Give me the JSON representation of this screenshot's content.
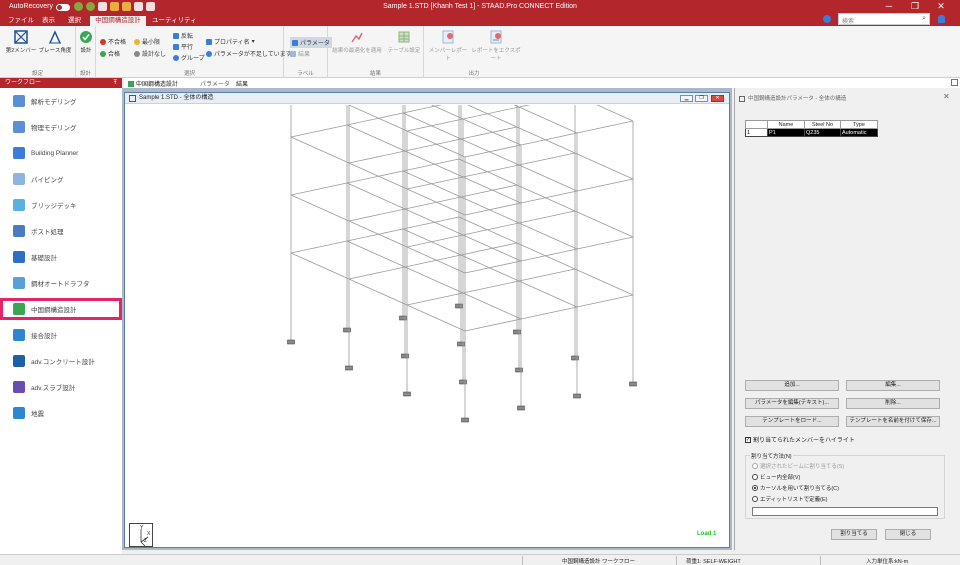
{
  "titlebar": {
    "autorecovery": "AutoRecovery",
    "toggle_state": "on",
    "title": "Sample 1.STD [Khanh Test 1] - STAAD.Pro CONNECT Edition",
    "minimize": "─",
    "restore": "❐",
    "close": "✕"
  },
  "menu": {
    "tabs": [
      "ファイル",
      "表示",
      "選択",
      "中国鋼構造設計",
      "ユーティリティ"
    ],
    "active": "中国鋼構造設計",
    "search_placeholder": "検索"
  },
  "ribbon": {
    "settings": {
      "btn1": "第2メンバー",
      "btn2": "ブレース角度",
      "label": "設定"
    },
    "design": {
      "btn": "設計",
      "label": "設計"
    },
    "select": {
      "fail": "不合格",
      "pass": "合格",
      "minimal": "最小限",
      "no_design": "設計なし",
      "reverse": "反転",
      "parallel": "平行",
      "group": "グループ",
      "property_name": "プロパティ名",
      "param_missing": "パラメータが不足しています",
      "label": "選択"
    },
    "label_group": {
      "params": "パラメータ",
      "results": "結果",
      "label": "ラベル"
    },
    "result_group": {
      "apply": "結果の最適化を適用",
      "table": "テーブル設定",
      "label": "結果"
    },
    "output_group": {
      "member_report": "メンバーレポート",
      "export": "レポートをエクスポート",
      "label": "出力"
    }
  },
  "doctabs": {
    "tab1": "中国鋼構造設計",
    "tab2": "パラメータ",
    "tab3": "結果"
  },
  "sidebar": {
    "header": "ワークフロー",
    "pin": "Ŧ",
    "items": [
      {
        "label": "解析モデリング",
        "color": "#5a8fd6"
      },
      {
        "label": "物理モデリング",
        "color": "#5a8fd6"
      },
      {
        "label": "Building Planner",
        "color": "#3b7dd8"
      },
      {
        "label": "パイピング",
        "color": "#8fb3e3"
      },
      {
        "label": "ブリッジデッキ",
        "color": "#5ab0e0"
      },
      {
        "label": "ポスト処理",
        "color": "#4a7ac0"
      },
      {
        "label": "基礎設計",
        "color": "#2e6fc5"
      },
      {
        "label": "鋼材オートドラフタ",
        "color": "#5aa0d6"
      },
      {
        "label": "中国鋼構造設計",
        "color": "#3aa655"
      },
      {
        "label": "接合設計",
        "color": "#2e86d0"
      },
      {
        "label": "adv.コンクリート設計",
        "color": "#1f5fa8"
      },
      {
        "label": "adv.スラブ設計",
        "color": "#6b4bb5"
      },
      {
        "label": "地震",
        "color": "#2e86d0"
      }
    ],
    "highlighted_index": 8
  },
  "viewport": {
    "title": "Sample 1.STD - 全体の構造",
    "axis_y": "Y",
    "axis_x": "X",
    "axis_z": "Z",
    "load_label": "Load 1"
  },
  "panel": {
    "title": "中国鋼構造設計パラメータ - 全体の構造",
    "close": "✕",
    "table": {
      "headers": [
        "",
        "Name",
        "Steel No",
        "Type"
      ],
      "rows": [
        [
          "1",
          "P1",
          "Q235",
          "Automatic"
        ]
      ]
    },
    "buttons": {
      "add": "追加...",
      "edit": "編集...",
      "edit_text": "パラメータを編集(テキスト)...",
      "delete": "削除...",
      "load_template": "テンプレートをロード...",
      "save_template": "テンプレートを名前を付けて保存...",
      "assign": "割り当てる",
      "close": "閉じる"
    },
    "highlight_check": "割り当てられたメンバーをハイライト",
    "assign_method": {
      "legend": "割り当て方法(N)",
      "opt1": "選択されたビームに割り当てる(S)",
      "opt2": "ビュー内全部(V)",
      "opt3": "カーソルを用いて割り当てる(C)",
      "opt4": "エディットリストで定義(E)",
      "selected": 3
    }
  },
  "status": {
    "workflow": "中国鋼構造設計 ワークフロー",
    "load": "荷重1: SELF-WEIGHT",
    "units": "入力単位系:kN-m"
  },
  "colors": {
    "brand": "#b3262c",
    "highlight_outline": "#e3236a",
    "load_text": "#19c519"
  }
}
